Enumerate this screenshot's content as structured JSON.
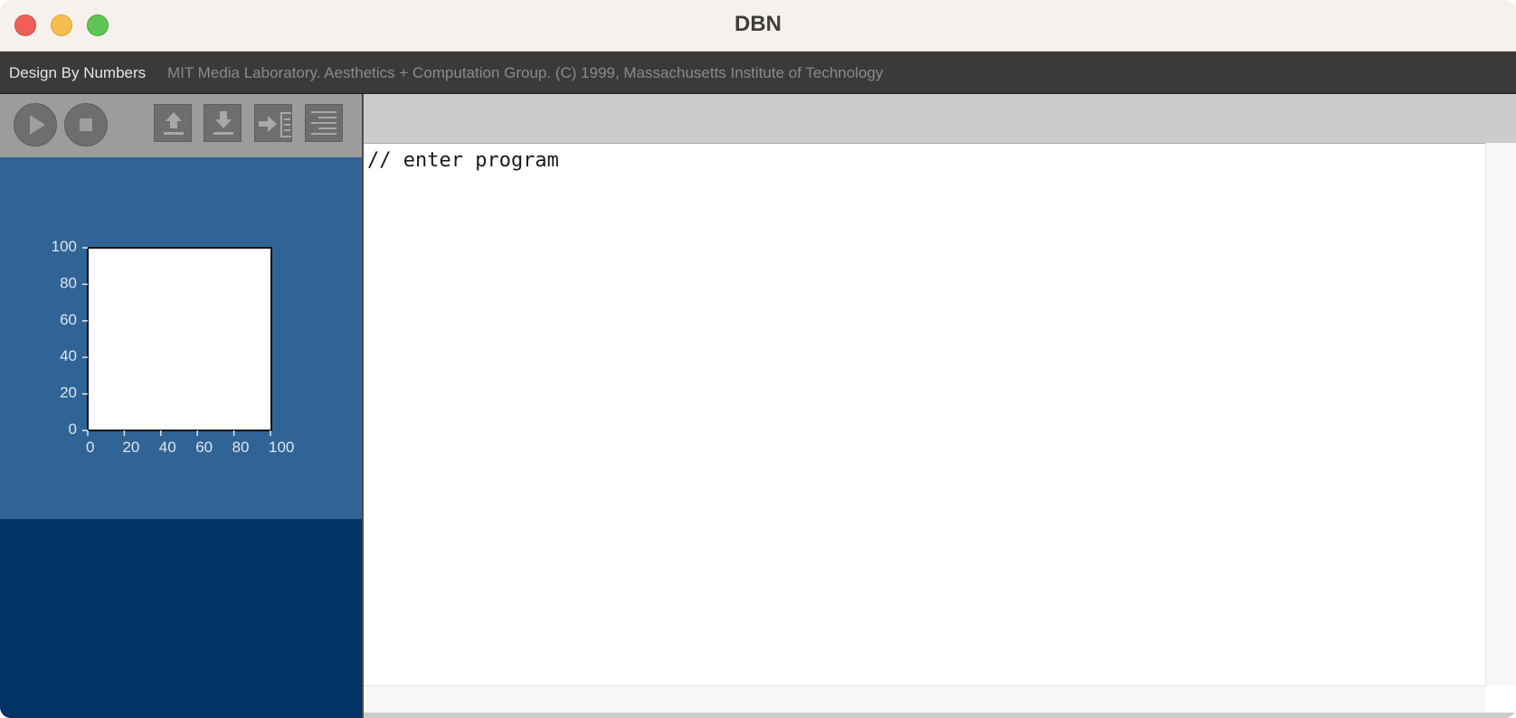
{
  "window": {
    "title": "DBN"
  },
  "banner": {
    "app_name": "Design By Numbers",
    "credit": "MIT Media Laboratory. Aesthetics + Computation Group. (C) 1999, Massachusetts Institute of Technology"
  },
  "toolbar": {
    "buttons": [
      {
        "name": "run",
        "icon": "play-icon"
      },
      {
        "name": "stop",
        "icon": "stop-icon"
      },
      {
        "name": "open",
        "icon": "upload-icon"
      },
      {
        "name": "save",
        "icon": "download-icon"
      },
      {
        "name": "share",
        "icon": "send-icon"
      },
      {
        "name": "print",
        "icon": "lines-icon"
      }
    ]
  },
  "canvas": {
    "y_ticks": [
      "100",
      "80",
      "60",
      "40",
      "20",
      "0"
    ],
    "x_ticks": [
      "0",
      "20",
      "40",
      "60",
      "80",
      "100"
    ],
    "range": [
      0,
      100
    ],
    "fill_color": "#ffffff"
  },
  "editor": {
    "content": "// enter program"
  },
  "colors": {
    "canvas_panel": "#316496",
    "bottom_panel": "#003366",
    "toolbar": "#9c9c9c",
    "banner": "#3a3a3a"
  }
}
